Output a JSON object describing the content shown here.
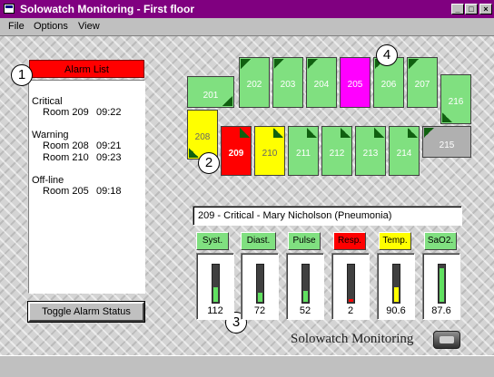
{
  "window": {
    "title": "Solowatch Monitoring - First floor"
  },
  "menu": {
    "items": [
      "File",
      "Options",
      "View"
    ]
  },
  "alarm_list": {
    "title": "Alarm List",
    "groups": [
      {
        "heading": "Critical",
        "entries": [
          {
            "room": "Room 209",
            "time": "09:22"
          }
        ]
      },
      {
        "heading": "Warning",
        "entries": [
          {
            "room": "Room 208",
            "time": "09:21"
          },
          {
            "room": "Room 210",
            "time": "09:23"
          }
        ]
      },
      {
        "heading": "Off-line",
        "entries": [
          {
            "room": "Room 205",
            "time": "09:18"
          }
        ]
      }
    ],
    "toggle_label": "Toggle Alarm Status"
  },
  "callouts": [
    "1",
    "2",
    "3",
    "4"
  ],
  "rooms": [
    {
      "number": "201",
      "state": "normal"
    },
    {
      "number": "202",
      "state": "normal"
    },
    {
      "number": "203",
      "state": "normal"
    },
    {
      "number": "204",
      "state": "normal"
    },
    {
      "number": "205",
      "state": "off-line"
    },
    {
      "number": "206",
      "state": "normal"
    },
    {
      "number": "207",
      "state": "normal"
    },
    {
      "number": "216",
      "state": "normal"
    },
    {
      "number": "208",
      "state": "warning"
    },
    {
      "number": "209",
      "state": "critical"
    },
    {
      "number": "210",
      "state": "warning"
    },
    {
      "number": "211",
      "state": "normal"
    },
    {
      "number": "212",
      "state": "normal"
    },
    {
      "number": "213",
      "state": "normal"
    },
    {
      "number": "214",
      "state": "normal"
    },
    {
      "number": "215",
      "state": "inactive"
    }
  ],
  "state_colors": {
    "normal": "#80e080",
    "warning": "#ffff00",
    "critical": "#ff0000",
    "off-line": "#ff00ff",
    "inactive": "#b0b0b0"
  },
  "selected_patient": "209 - Critical - Mary Nicholson  (Pneumonia)",
  "vitals": [
    {
      "label": "Syst.",
      "value": "112",
      "level": 0.4,
      "label_color": "#80e080",
      "fill_color": "#60e060"
    },
    {
      "label": "Diast.",
      "value": "72",
      "level": 0.25,
      "label_color": "#80e080",
      "fill_color": "#60e060"
    },
    {
      "label": "Pulse",
      "value": "52",
      "level": 0.3,
      "label_color": "#80e080",
      "fill_color": "#60e060"
    },
    {
      "label": "Resp.",
      "value": "2",
      "level": 0.08,
      "label_color": "#ff0000",
      "fill_color": "#ff0000"
    },
    {
      "label": "Temp.",
      "value": "90.6",
      "level": 0.4,
      "label_color": "#ffff00",
      "fill_color": "#ffff00"
    },
    {
      "label": "SaO2.",
      "value": "87.6",
      "level": 0.92,
      "label_color": "#80e080",
      "fill_color": "#60e060"
    }
  ],
  "brand": {
    "text": "Solowatch Monitoring",
    "logo_icon": "monitor-logo-icon"
  }
}
